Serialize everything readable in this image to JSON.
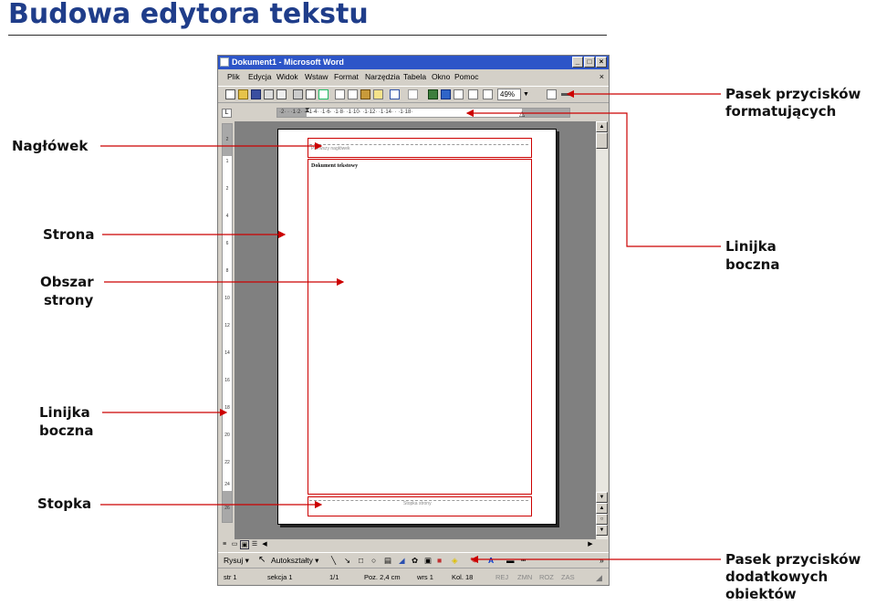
{
  "slide": {
    "title": "Budowa edytora tekstu"
  },
  "labels": {
    "header": "Nagłówek",
    "page": "Strona",
    "page_area_1": "Obszar",
    "page_area_2": "strony",
    "left_ruler_1": "Linijka",
    "left_ruler_2": "boczna",
    "footer": "Stopka",
    "format_toolbar_1": "Pasek przycisków",
    "format_toolbar_2": "formatujących",
    "right_ruler_1": "Linijka",
    "right_ruler_2": "boczna",
    "objects_toolbar_1": "Pasek przycisków",
    "objects_toolbar_2": "dodatkowych",
    "objects_toolbar_3": "obiektów"
  },
  "window": {
    "title": "Dokument1 - Microsoft Word",
    "menu": [
      "Plik",
      "Edycja",
      "Widok",
      "Wstaw",
      "Format",
      "Narzędzia",
      "Tabela",
      "Okno",
      "Pomoc"
    ],
    "close_doc": "×",
    "zoom": "49%"
  },
  "hruler": {
    "marks": "·2·  ·  ·1·2·  ·  ·1·4·  ·1·6·  ·1·8·  ·1·10·  ·1·12·  ·1·14·  ·  ·1·18·"
  },
  "vruler": {
    "marks": [
      "2",
      "1",
      "2",
      "4",
      "6",
      "8",
      "10",
      "12",
      "14",
      "16",
      "18",
      "20",
      "22",
      "24",
      "26"
    ]
  },
  "page": {
    "header_text": "Pierwszy nagłówek",
    "body_text": "Dokument tekstowy",
    "footer_text": "Stopka strony"
  },
  "drawbar": {
    "draw": "Rysuj ▾",
    "autoshapes": "Autokształty ▾"
  },
  "status": {
    "page": "str 1",
    "section": "sekcja 1",
    "pages": "1/1",
    "position": "Poz. 2,4 cm",
    "line": "wrs 1",
    "column": "Kol. 18",
    "rej": "REJ",
    "zmn": "ZMN",
    "roz": "ROZ",
    "zas": "ZAS"
  },
  "colors": {
    "title": "#1f3d8a",
    "arrow": "#cc0000",
    "titlebar": "#2d55c8"
  }
}
